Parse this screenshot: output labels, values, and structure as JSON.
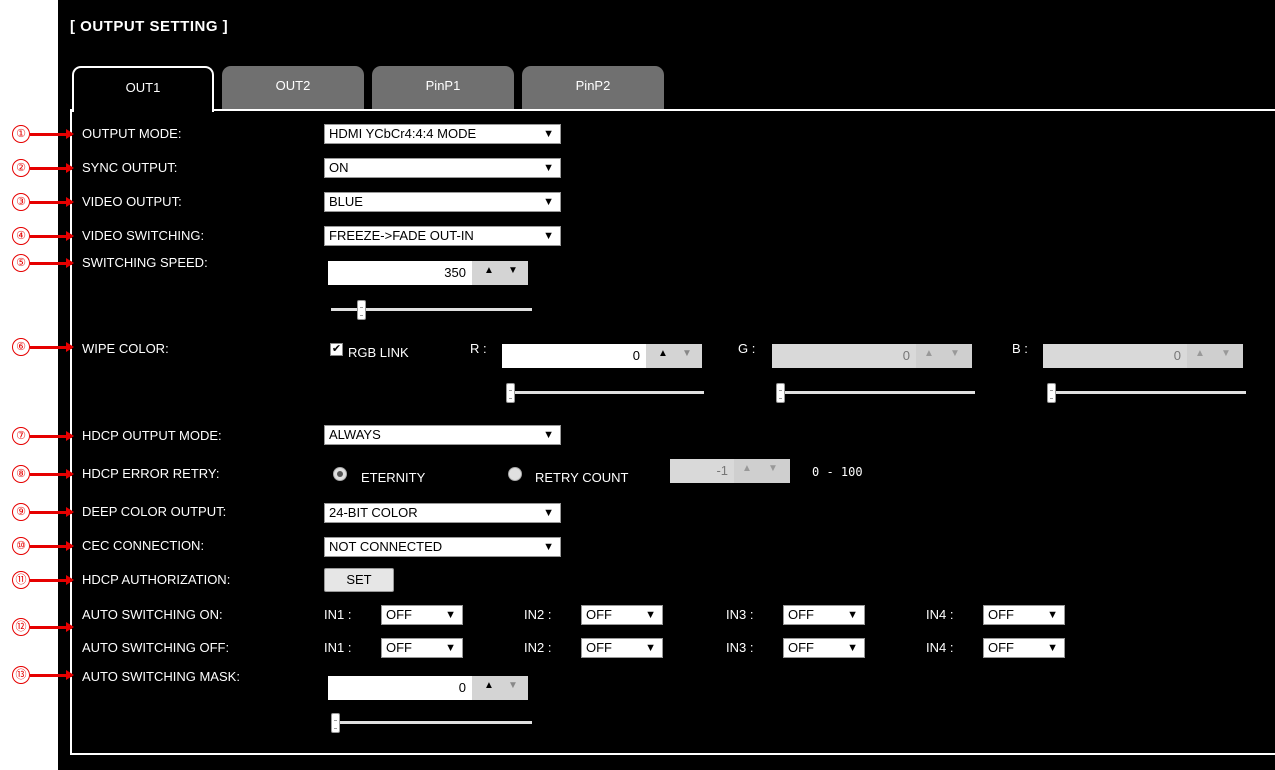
{
  "header": {
    "title": "[ OUTPUT SETTING ]"
  },
  "tabs": [
    {
      "label": "OUT1",
      "active": true
    },
    {
      "label": "OUT2",
      "active": false
    },
    {
      "label": "PinP1",
      "active": false
    },
    {
      "label": "PinP2",
      "active": false
    }
  ],
  "markers": [
    "①",
    "②",
    "③",
    "④",
    "⑤",
    "⑥",
    "⑦",
    "⑧",
    "⑨",
    "⑩",
    "⑪",
    "⑫",
    "⑬"
  ],
  "fields": {
    "output_mode": {
      "label": "OUTPUT MODE:",
      "value": "HDMI YCbCr4:4:4 MODE"
    },
    "sync_output": {
      "label": "SYNC OUTPUT:",
      "value": "ON"
    },
    "video_output": {
      "label": "VIDEO OUTPUT:",
      "value": "BLUE"
    },
    "video_switching": {
      "label": "VIDEO SWITCHING:",
      "value": "FREEZE->FADE OUT-IN"
    },
    "switching_speed": {
      "label": "SWITCHING SPEED:",
      "value": "350"
    },
    "wipe_color": {
      "label": "WIPE COLOR:",
      "rgb_link_label": "RGB LINK",
      "rgb_link_checked": true,
      "r_label": "R :",
      "r_value": "0",
      "g_label": "G :",
      "g_value": "0",
      "b_label": "B :",
      "b_value": "0"
    },
    "hdcp_output_mode": {
      "label": "HDCP OUTPUT MODE:",
      "value": "ALWAYS"
    },
    "hdcp_error_retry": {
      "label": "HDCP ERROR RETRY:",
      "eternity_label": "ETERNITY",
      "retry_count_label": "RETRY COUNT",
      "selected": "ETERNITY",
      "retry_count_value": "-1",
      "range": "0 - 100"
    },
    "deep_color_output": {
      "label": "DEEP COLOR OUTPUT:",
      "value": "24-BIT COLOR"
    },
    "cec_connection": {
      "label": "CEC CONNECTION:",
      "value": "NOT CONNECTED"
    },
    "hdcp_authorization": {
      "label": "HDCP AUTHORIZATION:",
      "button": "SET"
    },
    "auto_switching_on": {
      "label": "AUTO SWITCHING ON:",
      "inputs": [
        {
          "label": "IN1 :",
          "value": "OFF"
        },
        {
          "label": "IN2 :",
          "value": "OFF"
        },
        {
          "label": "IN3 :",
          "value": "OFF"
        },
        {
          "label": "IN4 :",
          "value": "OFF"
        }
      ]
    },
    "auto_switching_off": {
      "label": "AUTO SWITCHING OFF:",
      "inputs": [
        {
          "label": "IN1 :",
          "value": "OFF"
        },
        {
          "label": "IN2 :",
          "value": "OFF"
        },
        {
          "label": "IN3 :",
          "value": "OFF"
        },
        {
          "label": "IN4 :",
          "value": "OFF"
        }
      ]
    },
    "auto_switching_mask": {
      "label": "AUTO SWITCHING MASK:",
      "value": "0"
    }
  },
  "colors": {
    "marker": "#e60000",
    "panel_bg": "#000000",
    "tab_inactive": "#707070"
  }
}
